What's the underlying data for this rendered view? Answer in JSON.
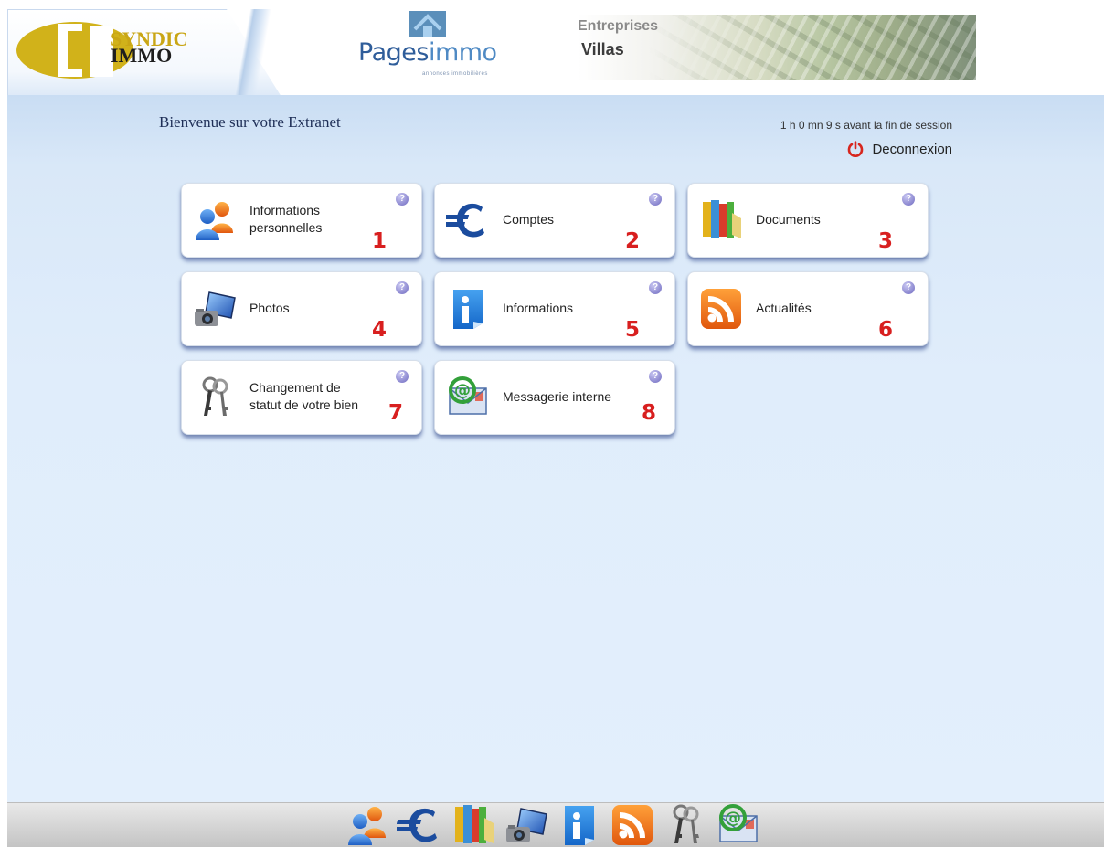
{
  "header": {
    "syndic_logo": {
      "line1": "SYNDIC",
      "line2": "IMMO"
    },
    "pagesimmo_logo": {
      "part1": "Pages",
      "part2": "immo",
      "subtitle": "annonces immobilières"
    },
    "banner": {
      "word1": "Entreprises",
      "word2": "Villas"
    }
  },
  "main": {
    "welcome": "Bienvenue sur votre Extranet",
    "session_timer": "1 h 0 mn 9 s avant la fin de session",
    "logout_label": "Deconnexion",
    "help_symbol": "?",
    "tiles": [
      {
        "line1": "Informations",
        "line2": "personnelles",
        "number": "1",
        "icon": "people-icon"
      },
      {
        "line1": "Comptes",
        "line2": "",
        "number": "2",
        "icon": "euro-icon"
      },
      {
        "line1": "Documents",
        "line2": "",
        "number": "3",
        "icon": "books-icon"
      },
      {
        "line1": "Photos",
        "line2": "",
        "number": "4",
        "icon": "camera-icon"
      },
      {
        "line1": "Informations",
        "line2": "",
        "number": "5",
        "icon": "info-icon"
      },
      {
        "line1": "Actualités",
        "line2": "",
        "number": "6",
        "icon": "rss-icon"
      },
      {
        "line1": "Changement de",
        "line2": "statut de votre bien",
        "number": "7",
        "icon": "keys-icon"
      },
      {
        "line1": "Messagerie interne",
        "line2": "",
        "number": "8",
        "icon": "mail-icon"
      }
    ]
  },
  "dock": {
    "icons": [
      "people-icon",
      "euro-icon",
      "books-icon",
      "camera-icon",
      "info-icon",
      "rss-icon",
      "keys-icon",
      "mail-icon"
    ]
  },
  "colors": {
    "accent_blue": "#2f5d9a",
    "tile_number_red": "#d81f1f",
    "background_blue": "#e0edfb",
    "help_purple": "#8a86cf"
  }
}
